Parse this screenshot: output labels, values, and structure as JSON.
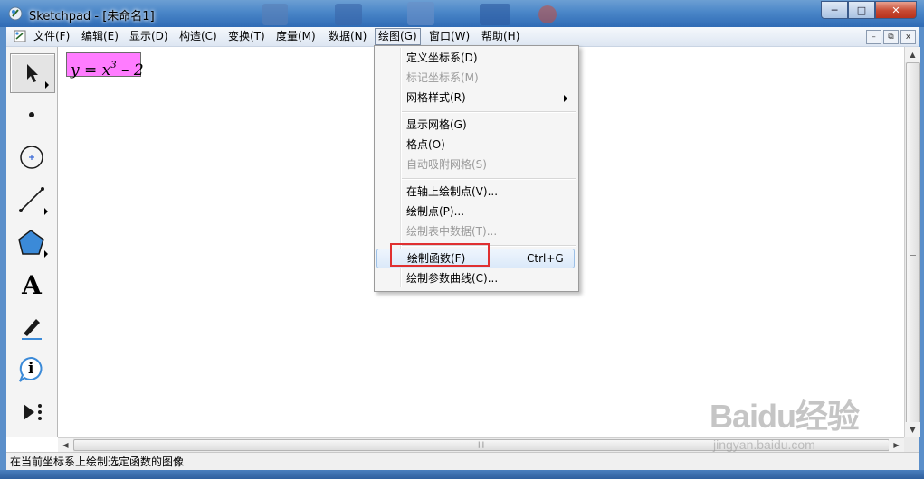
{
  "window": {
    "app_name": "Sketchpad",
    "title": "Sketchpad  - [未命名1]",
    "minimize": "─",
    "maximize": "□",
    "close": "✕"
  },
  "menubar": {
    "items": [
      {
        "label": "文件(F)"
      },
      {
        "label": "编辑(E)"
      },
      {
        "label": "显示(D)"
      },
      {
        "label": "构造(C)"
      },
      {
        "label": "变换(T)"
      },
      {
        "label": "度量(M)"
      },
      {
        "label": "数据(N)"
      },
      {
        "label": "绘图(G)",
        "active": true
      },
      {
        "label": "窗口(W)"
      },
      {
        "label": "帮助(H)"
      }
    ],
    "doc_buttons": {
      "minimize": "–",
      "restore": "⧉",
      "close": "x"
    }
  },
  "toolbox": {
    "tools": [
      "arrow-tool",
      "point-tool",
      "compass-tool",
      "straightedge-tool",
      "polygon-tool",
      "text-tool",
      "marker-tool",
      "information-tool",
      "custom-tool"
    ],
    "text_tool_glyph": "A",
    "info_tool_glyph": "i"
  },
  "canvas": {
    "formula": {
      "lhs": "y = x",
      "exponent": "3",
      "rhs": " – 2",
      "background": "#ff7cff"
    }
  },
  "dropdown_menu": {
    "owner": "绘图(G)",
    "items": [
      {
        "label": "定义坐标系(D)",
        "enabled": true
      },
      {
        "label": "标记坐标系(M)",
        "enabled": false
      },
      {
        "label": "网格样式(R)",
        "enabled": true,
        "submenu": true
      },
      {
        "separator": true
      },
      {
        "label": "显示网格(G)",
        "enabled": true
      },
      {
        "label": "格点(O)",
        "enabled": true
      },
      {
        "label": "自动吸附网格(S)",
        "enabled": false
      },
      {
        "separator": true
      },
      {
        "label": "在轴上绘制点(V)...",
        "enabled": true
      },
      {
        "label": "绘制点(P)...",
        "enabled": true
      },
      {
        "label": "绘制表中数据(T)...",
        "enabled": false
      },
      {
        "separator": true
      },
      {
        "label": "绘制函数(F)",
        "shortcut": "Ctrl+G",
        "enabled": true,
        "highlighted": true
      },
      {
        "label": "绘制参数曲线(C)...",
        "enabled": true
      }
    ],
    "highlight_color": "#e03030"
  },
  "statusbar": {
    "text": "在当前坐标系上绘制选定函数的图像"
  },
  "watermark": {
    "brand": "Baidu经验",
    "url": "jingyan.baidu.com"
  }
}
